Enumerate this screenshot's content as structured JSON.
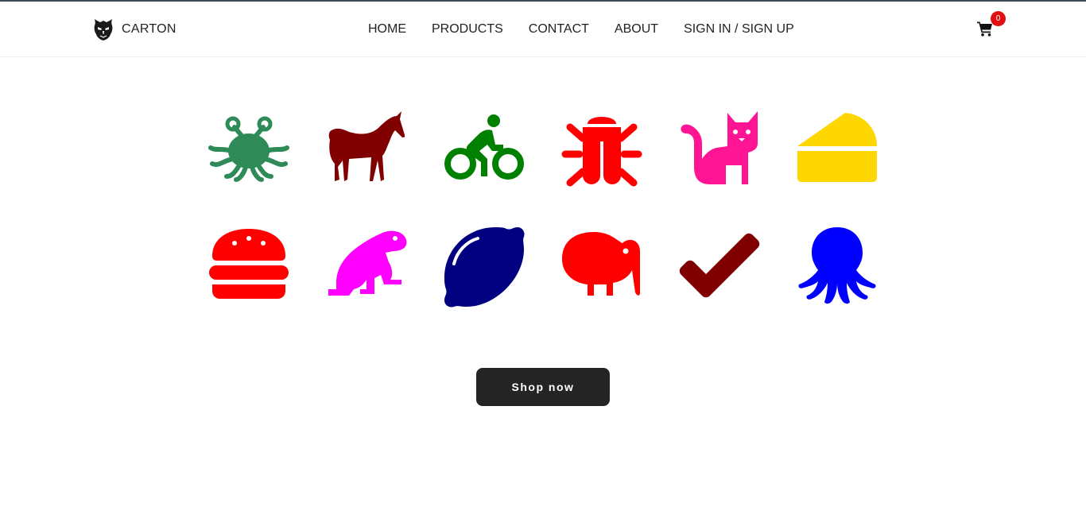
{
  "brand": {
    "name": "CARTON",
    "logo_icon": "mask-logo-icon"
  },
  "nav": {
    "items": [
      {
        "label": "HOME"
      },
      {
        "label": "PRODUCTS"
      },
      {
        "label": "CONTACT"
      },
      {
        "label": "ABOUT"
      },
      {
        "label": "SIGN IN / SIGN UP"
      }
    ]
  },
  "cart": {
    "icon": "shopping-cart-icon",
    "count": "0",
    "badge_color": "#e01010"
  },
  "gallery": {
    "icons": [
      {
        "name": "flying-spaghetti-monster-icon",
        "color": "#2e8b57"
      },
      {
        "name": "horse-icon",
        "color": "#800000"
      },
      {
        "name": "cyclist-icon",
        "color": "#008000"
      },
      {
        "name": "bug-icon",
        "color": "#ff0000"
      },
      {
        "name": "cat-icon",
        "color": "#ff1493"
      },
      {
        "name": "cheese-icon",
        "color": "#ffd700"
      },
      {
        "name": "hamburger-icon",
        "color": "#ff0000"
      },
      {
        "name": "frog-icon",
        "color": "#ff00ff"
      },
      {
        "name": "lemon-icon",
        "color": "#000080"
      },
      {
        "name": "kiwi-bird-icon",
        "color": "#ff0000"
      },
      {
        "name": "check-icon",
        "color": "#800000"
      },
      {
        "name": "octopus-icon",
        "color": "#0000ff"
      }
    ]
  },
  "cta": {
    "label": "Shop now",
    "background": "#242424"
  }
}
